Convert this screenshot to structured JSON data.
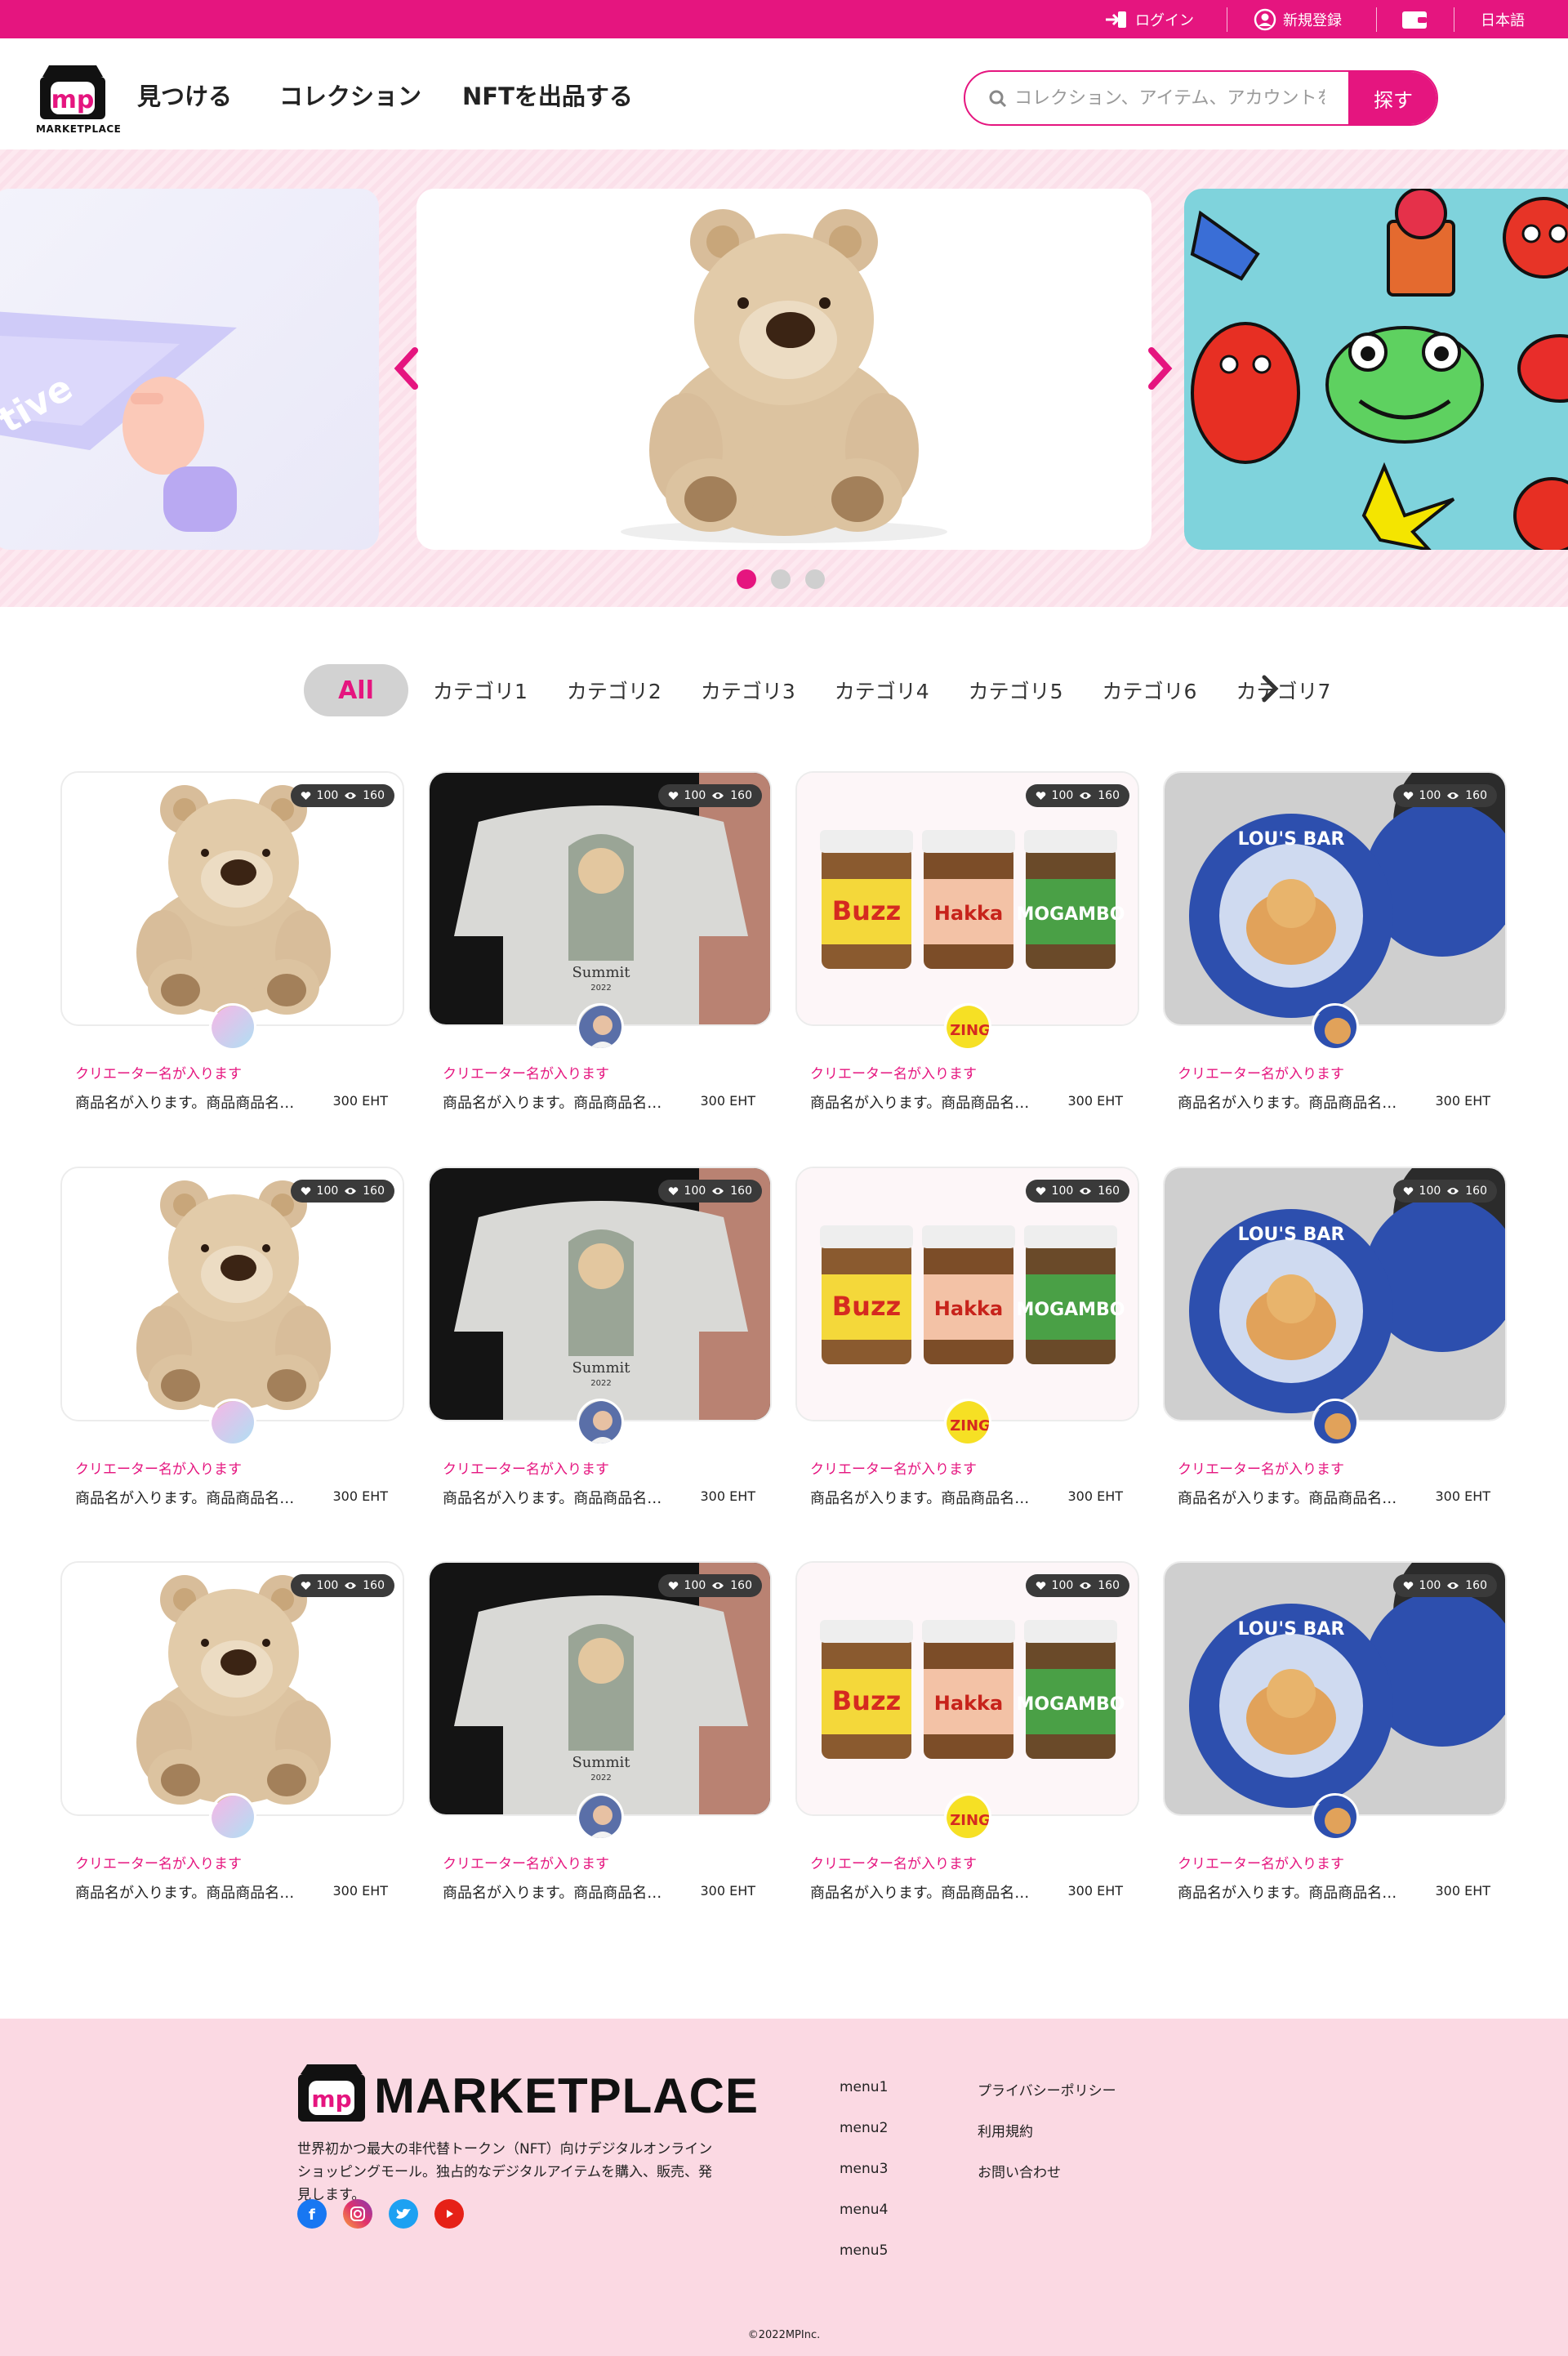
{
  "topbar": {
    "login": "ログイン",
    "register": "新規登録",
    "language": "日本語"
  },
  "header": {
    "logo_text": "MARKETPLACE",
    "nav": [
      "見つける",
      "コレクション",
      "NFTを出品する"
    ],
    "search_placeholder": "コレクション、アイテム、アカウントを探す",
    "search_button": "探す"
  },
  "hero": {
    "slides": [
      "left-slide",
      "teddy-bear",
      "sticker-art"
    ],
    "active_slide": 1
  },
  "categories": {
    "all": "All",
    "items": [
      "カテゴリ1",
      "カテゴリ2",
      "カテゴリ3",
      "カテゴリ4",
      "カテゴリ5",
      "カテゴリ6",
      "カテゴリ7"
    ]
  },
  "cards": [
    {
      "likes": "100",
      "views": "160",
      "creator": "クリエーター名が入ります",
      "name": "商品名が入ります。商品商品名が...",
      "price": "300 EHT"
    },
    {
      "likes": "100",
      "views": "160",
      "creator": "クリエーター名が入ります",
      "name": "商品名が入ります。商品商品名が...",
      "price": "300 EHT"
    },
    {
      "likes": "100",
      "views": "160",
      "creator": "クリエーター名が入ります",
      "name": "商品名が入ります。商品商品名が...",
      "price": "300 EHT"
    },
    {
      "likes": "100",
      "views": "160",
      "creator": "クリエーター名が入ります",
      "name": "商品名が入ります。商品商品名が...",
      "price": "300 EHT"
    },
    {
      "likes": "100",
      "views": "160",
      "creator": "クリエーター名が入ります",
      "name": "商品名が入ります。商品商品名が...",
      "price": "300 EHT"
    },
    {
      "likes": "100",
      "views": "160",
      "creator": "クリエーター名が入ります",
      "name": "商品名が入ります。商品商品名が...",
      "price": "300 EHT"
    },
    {
      "likes": "100",
      "views": "160",
      "creator": "クリエーター名が入ります",
      "name": "商品名が入ります。商品商品名が...",
      "price": "300 EHT"
    },
    {
      "likes": "100",
      "views": "160",
      "creator": "クリエーター名が入ります",
      "name": "商品名が入ります。商品商品名が...",
      "price": "300 EHT"
    },
    {
      "likes": "100",
      "views": "160",
      "creator": "クリエーター名が入ります",
      "name": "商品名が入ります。商品商品名が...",
      "price": "300 EHT"
    },
    {
      "likes": "100",
      "views": "160",
      "creator": "クリエーター名が入ります",
      "name": "商品名が入ります。商品商品名が...",
      "price": "300 EHT"
    },
    {
      "likes": "100",
      "views": "160",
      "creator": "クリエーター名が入ります",
      "name": "商品名が入ります。商品商品名が...",
      "price": "300 EHT"
    },
    {
      "likes": "100",
      "views": "160",
      "creator": "クリエーター名が入ります",
      "name": "商品名が入ります。商品商品名が...",
      "price": "300 EHT"
    }
  ],
  "footer": {
    "brand": "MARKETPLACE",
    "description": "世界初かつ最大の非代替トークン（NFT）向けデジタルオンラインショッピングモール。独占的なデジタルアイテムを購入、販売、発見します。",
    "menus": [
      "menu1",
      "menu2",
      "menu3",
      "menu4",
      "menu5"
    ],
    "links": [
      "プライバシーポリシー",
      "利用規約",
      "お問い合わせ"
    ],
    "copyright": "©2022MPInc."
  },
  "colors": {
    "accent": "#e5157f",
    "hero_bg": "#fde9f0",
    "footer_bg": "#fbd9e3"
  }
}
